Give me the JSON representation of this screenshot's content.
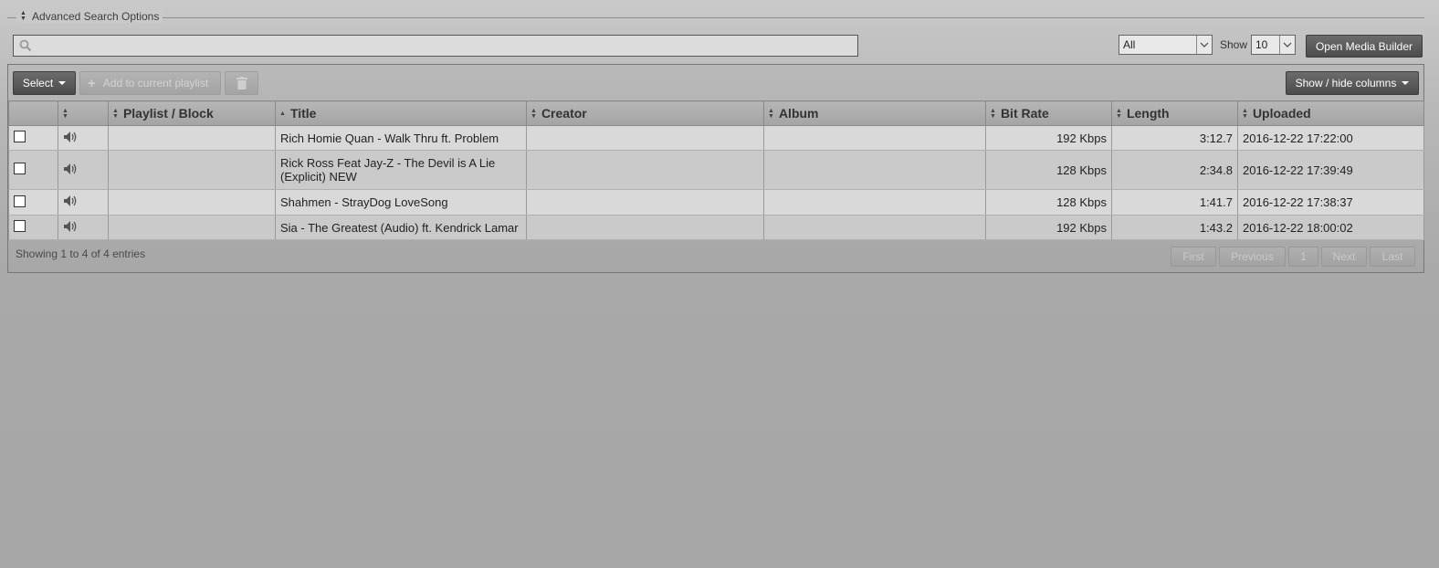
{
  "advanced_search": {
    "label": "Advanced Search Options"
  },
  "search": {
    "value": "",
    "placeholder": ""
  },
  "filter": {
    "selected": "All"
  },
  "page_size": {
    "label": "Show",
    "selected": "10"
  },
  "open_media_builder": {
    "label": "Open Media Builder"
  },
  "toolbar": {
    "select_label": "Select",
    "add_playlist_label": "Add to current playlist",
    "show_hide_columns_label": "Show / hide columns"
  },
  "columns": {
    "playlist": "Playlist / Block",
    "title": "Title",
    "creator": "Creator",
    "album": "Album",
    "bitrate": "Bit Rate",
    "length": "Length",
    "uploaded": "Uploaded"
  },
  "rows": [
    {
      "title": "Rich Homie Quan - Walk Thru ft. Problem",
      "creator": "",
      "album": "",
      "playlist": "",
      "bitrate": "192 Kbps",
      "length": "3:12.7",
      "uploaded": "2016-12-22 17:22:00"
    },
    {
      "title": "Rick Ross Feat Jay-Z - The Devil is A Lie (Explicit) NEW",
      "creator": "",
      "album": "",
      "playlist": "",
      "bitrate": "128 Kbps",
      "length": "2:34.8",
      "uploaded": "2016-12-22 17:39:49"
    },
    {
      "title": "Shahmen - StrayDog LoveSong",
      "creator": "",
      "album": "",
      "playlist": "",
      "bitrate": "128 Kbps",
      "length": "1:41.7",
      "uploaded": "2016-12-22 17:38:37"
    },
    {
      "title": "Sia - The Greatest (Audio) ft. Kendrick Lamar",
      "creator": "",
      "album": "",
      "playlist": "",
      "bitrate": "192 Kbps",
      "length": "1:43.2",
      "uploaded": "2016-12-22 18:00:02"
    }
  ],
  "footer": {
    "info": "Showing 1 to 4 of 4 entries",
    "pager": {
      "first": "First",
      "previous": "Previous",
      "page": "1",
      "next": "Next",
      "last": "Last"
    }
  }
}
